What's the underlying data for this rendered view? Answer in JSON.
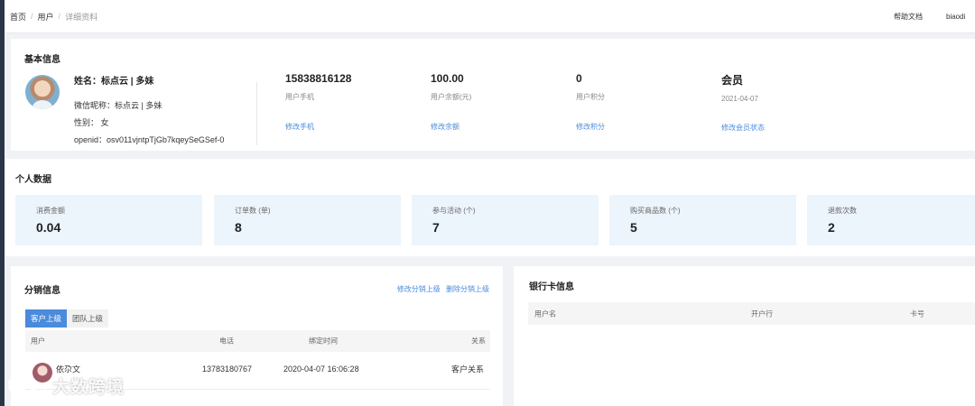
{
  "breadcrumb": [
    "首页",
    "用户",
    "详细资料"
  ],
  "header": {
    "help": "帮助文档",
    "user": "biaodi"
  },
  "basic_info": {
    "title": "基本信息",
    "name": "姓名：标点云 | 多妹",
    "wechat": "微信昵称：标点云 | 多妹",
    "gender": "性别： 女",
    "openid": "openid：osv011vjntpTjGb7kqeySeGSef-0",
    "stats": [
      {
        "value": "15838816128",
        "label": "用户手机",
        "link": "修改手机"
      },
      {
        "value": "100.00",
        "label": "用户余额(元)",
        "link": "修改余额"
      },
      {
        "value": "0",
        "label": "用户积分",
        "link": "修改积分"
      },
      {
        "value": "会员",
        "label": "2021-04-07",
        "link": "修改会员状态"
      }
    ]
  },
  "personal_data": {
    "title": "个人数据",
    "metrics": [
      {
        "label": "消费金额",
        "value": "0.04"
      },
      {
        "label": "订单数 (单)",
        "value": "8"
      },
      {
        "label": "参与活动 (个)",
        "value": "7"
      },
      {
        "label": "购买商品数 (个)",
        "value": "5"
      },
      {
        "label": "退款次数",
        "value": "2"
      }
    ]
  },
  "distribution": {
    "title": "分销信息",
    "actions": [
      "修改分销上级",
      "删除分销上级"
    ],
    "tabs": [
      "客户上级",
      "团队上级"
    ],
    "columns": [
      "用户",
      "电话",
      "绑定时间",
      "关系"
    ],
    "rows": [
      {
        "user": "依尕文",
        "phone": "13783180767",
        "time": "2020-04-07 16:06:28",
        "relation": "客户关系"
      }
    ]
  },
  "bank": {
    "title": "银行卡信息",
    "columns": [
      "用户名",
      "开户行",
      "卡号"
    ]
  },
  "watermark": {
    "text": "大数跨境"
  }
}
